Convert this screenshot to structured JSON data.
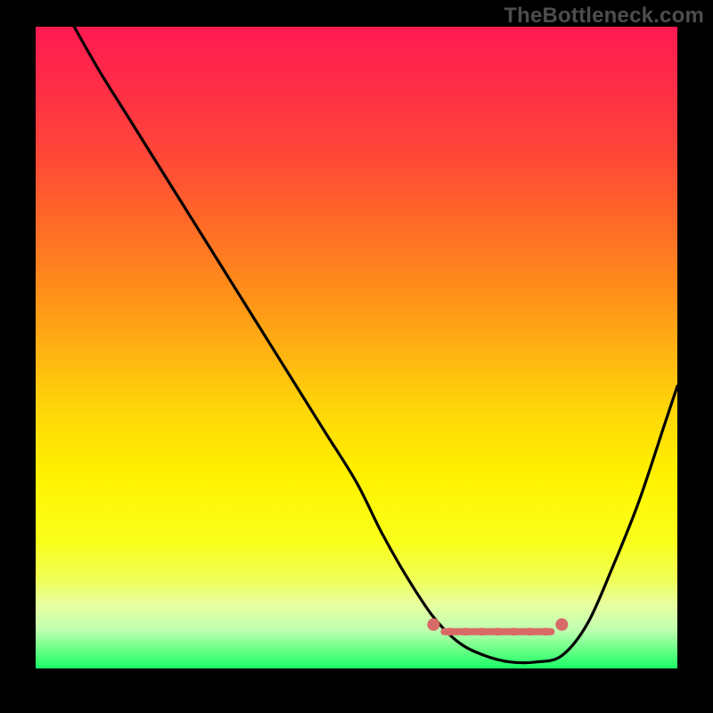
{
  "watermark": "TheBottleneck.com",
  "chart_data": {
    "type": "line",
    "title": "",
    "xlabel": "",
    "ylabel": "",
    "xlim": [
      0,
      100
    ],
    "ylim": [
      0,
      100
    ],
    "grid": false,
    "series": [
      {
        "name": "bottleneck-curve",
        "x": [
          6,
          10,
          15,
          20,
          25,
          30,
          35,
          40,
          45,
          50,
          54,
          58,
          62,
          66,
          70,
          74,
          78,
          82,
          86,
          90,
          94,
          98,
          100
        ],
        "y": [
          100,
          93,
          85,
          77,
          69,
          61,
          53,
          45,
          37,
          29,
          21,
          14,
          8,
          4,
          2,
          1,
          1,
          2,
          7,
          16,
          26,
          38,
          44
        ]
      }
    ],
    "flat_zone": {
      "x": [
        62,
        82
      ],
      "y": 6,
      "marker_color": "#d86a67"
    },
    "gradient_stops": [
      {
        "pos": 0.0,
        "color": "#ff1a51"
      },
      {
        "pos": 0.1,
        "color": "#ff2f46"
      },
      {
        "pos": 0.2,
        "color": "#ff4738"
      },
      {
        "pos": 0.3,
        "color": "#ff6828"
      },
      {
        "pos": 0.4,
        "color": "#ff8a1b"
      },
      {
        "pos": 0.5,
        "color": "#ffb012"
      },
      {
        "pos": 0.6,
        "color": "#ffd708"
      },
      {
        "pos": 0.7,
        "color": "#fff200"
      },
      {
        "pos": 0.8,
        "color": "#faff1a"
      },
      {
        "pos": 0.86,
        "color": "#f0ff55"
      },
      {
        "pos": 0.9,
        "color": "#e8ffa0"
      },
      {
        "pos": 0.94,
        "color": "#c0ffb0"
      },
      {
        "pos": 0.97,
        "color": "#6dff88"
      },
      {
        "pos": 1.0,
        "color": "#1aff66"
      }
    ]
  }
}
